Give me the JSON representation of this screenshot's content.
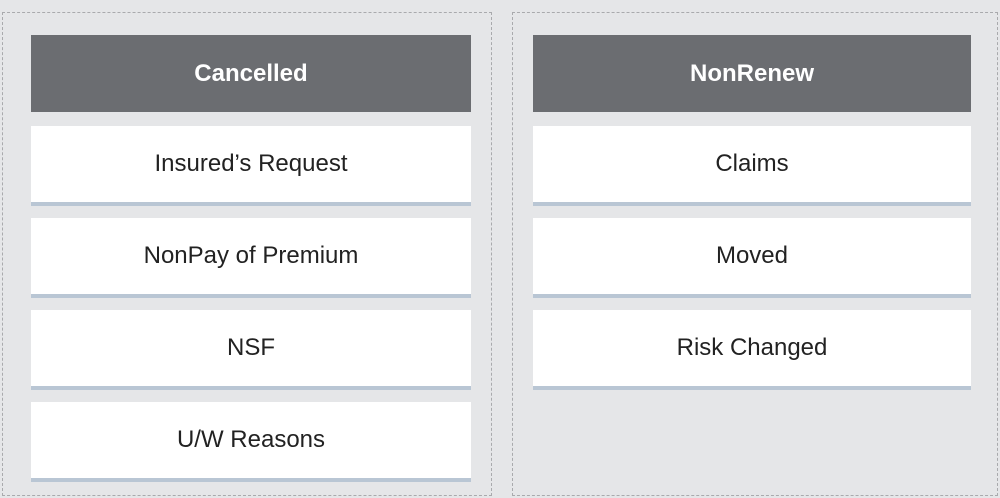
{
  "columns": [
    {
      "title": "Cancelled",
      "items": [
        {
          "label": "Insured’s Request"
        },
        {
          "label": "NonPay of Premium"
        },
        {
          "label": "NSF"
        },
        {
          "label": "U/W Reasons"
        }
      ]
    },
    {
      "title": "NonRenew",
      "items": [
        {
          "label": "Claims"
        },
        {
          "label": "Moved"
        },
        {
          "label": "Risk Changed"
        }
      ]
    }
  ],
  "colors": {
    "background": "#e5e6e8",
    "header": "#6b6d71",
    "card": "#ffffff",
    "card_underline": "#b9c6d4",
    "dashed_border": "#a9aaad"
  }
}
